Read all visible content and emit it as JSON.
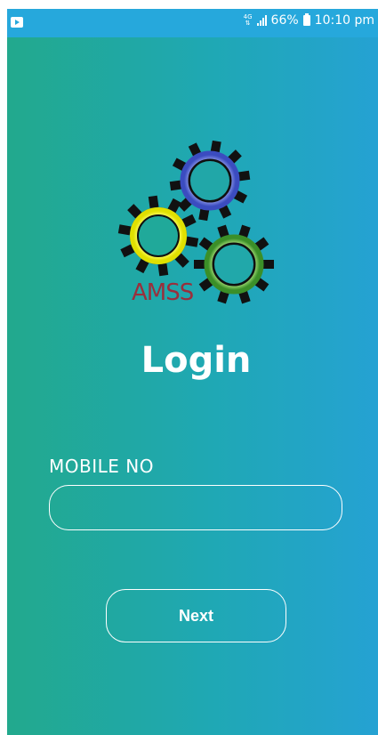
{
  "status_bar": {
    "network": "4G",
    "battery": "66%",
    "time": "10:10 pm"
  },
  "logo": {
    "text": "AMSS"
  },
  "login": {
    "title": "Login",
    "mobile_label": "MOBILE NO",
    "mobile_value": "",
    "next_label": "Next"
  },
  "colors": {
    "gradient_left": "#22a98d",
    "gradient_right": "#25a2d3",
    "status_bar": "#26a8dc",
    "logo_text": "#9a2f3c"
  }
}
